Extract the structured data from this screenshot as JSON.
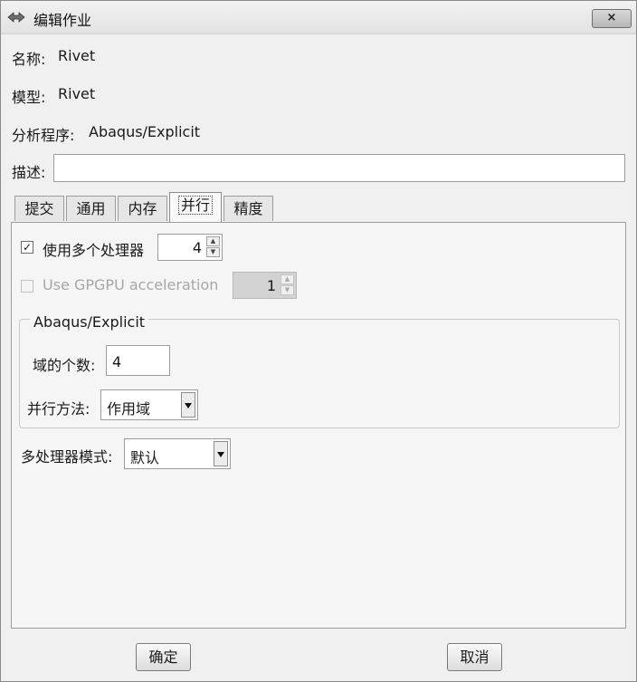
{
  "window": {
    "title": "编辑作业",
    "close_label": "×"
  },
  "fields": {
    "name_label": "名称:",
    "name_value": "Rivet",
    "model_label": "模型:",
    "model_value": "Rivet",
    "analysis_label": "分析程序:",
    "analysis_value": "Abaqus/Explicit",
    "description_label": "描述:",
    "description_value": ""
  },
  "tabs": [
    {
      "label": "提交",
      "active": false
    },
    {
      "label": "通用",
      "active": false
    },
    {
      "label": "内存",
      "active": false
    },
    {
      "label": "并行",
      "active": true
    },
    {
      "label": "精度",
      "active": false
    }
  ],
  "parallel": {
    "multi_cpu": {
      "label": "使用多个处理器",
      "checked": true,
      "value": "4"
    },
    "gpgpu": {
      "label": "Use GPGPU acceleration",
      "checked": false,
      "enabled": false,
      "value": "1"
    },
    "group": {
      "title": "Abaqus/Explicit",
      "domains_label": "域的个数:",
      "domains_value": "4",
      "method_label": "并行方法:",
      "method_value": "作用域"
    },
    "mode_label": "多处理器模式:",
    "mode_value": "默认"
  },
  "buttons": {
    "ok_label": "确定",
    "cancel_label": "取消"
  },
  "icons": {
    "app": "abaqus-app-icon",
    "checkmark": "✓",
    "spin_up": "▲",
    "spin_down": "▼",
    "dropdown": "chevron-down-icon"
  }
}
